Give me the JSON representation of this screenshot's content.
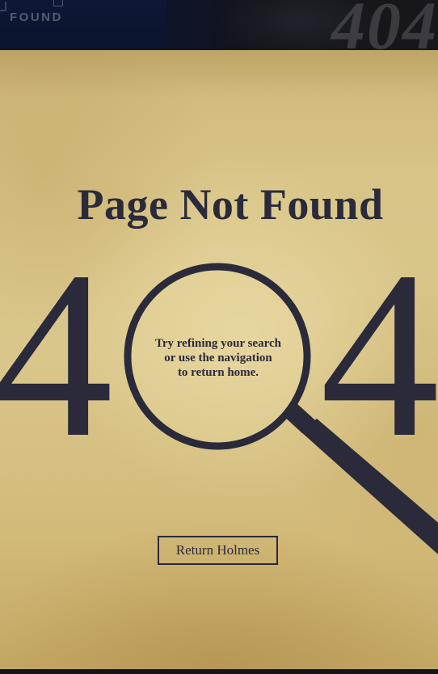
{
  "background": {
    "found_text": "FOUND",
    "ghost_number": "404"
  },
  "main": {
    "title": "Page Not Found",
    "error_code_left_digit": "4",
    "error_code_right_digit": "4",
    "hint_lines": [
      "Try refining your search",
      "or use the navigation",
      "to return home."
    ],
    "return_button_label": "Return Holmes"
  },
  "colors": {
    "ink": "#2a2a3a",
    "parchment": "#d9c68a",
    "backdrop": "#0f1015"
  },
  "icons": {
    "magnifier": "magnifying-glass-icon"
  }
}
